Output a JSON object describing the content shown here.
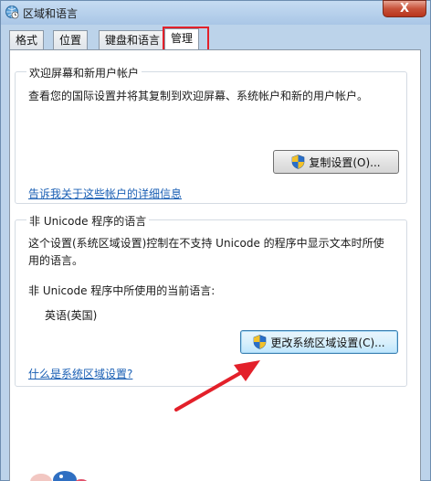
{
  "window": {
    "title": "区域和语言",
    "close_label": "X"
  },
  "tabs": [
    {
      "label": "格式"
    },
    {
      "label": "位置"
    },
    {
      "label": "键盘和语言"
    },
    {
      "label": "管理",
      "active": true
    }
  ],
  "welcome_group": {
    "title": "欢迎屏幕和新用户帐户",
    "description": "查看您的国际设置并将其复制到欢迎屏幕、系统帐户和新的用户帐户。",
    "copy_button": "复制设置(O)...",
    "link": "告诉我关于这些帐户的详细信息"
  },
  "unicode_group": {
    "title": "非 Unicode 程序的语言",
    "description_line1": "这个设置(系统区域设置)控制在不支持 Unicode 的程序中显示文本时所使",
    "description_line2": "用的语言。",
    "current_label": "非 Unicode 程序中所使用的当前语言:",
    "current_value": "英语(英国)",
    "change_button": "更改系统区域设置(C)...",
    "link": "什么是系统区域设置?"
  },
  "colors": {
    "annotation_red": "#e3202a",
    "link_blue": "#1a5fb4",
    "titlebar": "#bcd3ea"
  }
}
